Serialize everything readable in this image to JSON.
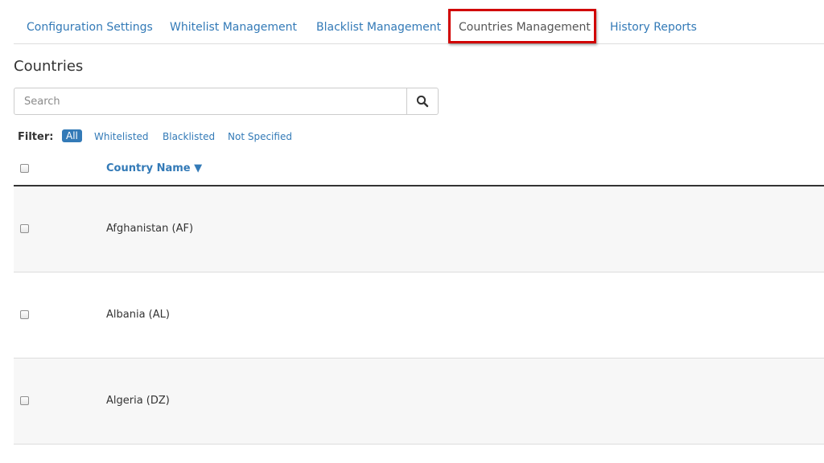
{
  "tabs": [
    {
      "label": "Configuration Settings"
    },
    {
      "label": "Whitelist Management"
    },
    {
      "label": "Blacklist Management"
    },
    {
      "label": "Countries Management",
      "active": true
    },
    {
      "label": "History Reports"
    }
  ],
  "page": {
    "heading": "Countries"
  },
  "search": {
    "placeholder": "Search",
    "value": "",
    "icon": "search-icon"
  },
  "filter": {
    "label": "Filter:",
    "options": [
      {
        "label": "All",
        "selected": true
      },
      {
        "label": "Whitelisted"
      },
      {
        "label": "Blacklisted"
      },
      {
        "label": "Not Specified"
      }
    ]
  },
  "table": {
    "columns": [
      {
        "label": "Country Name ▼",
        "sort": "desc-indicator"
      }
    ],
    "rows": [
      {
        "name": "Afghanistan (AF)"
      },
      {
        "name": "Albania (AL)"
      },
      {
        "name": "Algeria (DZ)"
      }
    ]
  },
  "colors": {
    "link": "#337ab7",
    "highlight_border": "#d10000",
    "row_alt": "#f7f7f7"
  }
}
